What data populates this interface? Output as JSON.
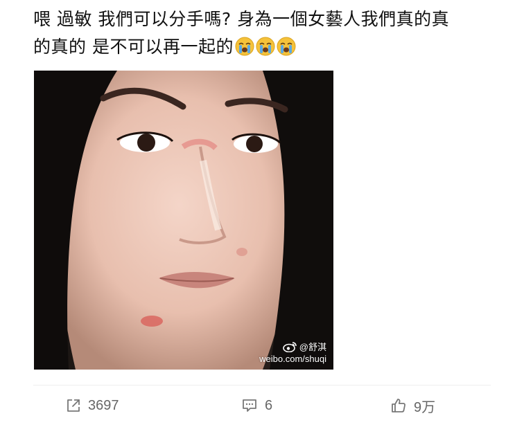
{
  "post": {
    "text_line1": "喂 過敏 我們可以分手嗎? 身為一個女藝人我們真的真",
    "text_line2": "的真的 是不可以再一起的"
  },
  "photo": {
    "watermark_user": "@舒淇",
    "watermark_url": "weibo.com/shuqi"
  },
  "actions": {
    "repost_count": "3697",
    "comment_count": "6",
    "like_count": "9万"
  },
  "colors": {
    "text": "#111111",
    "action_text": "#666666",
    "emoji_face": "#f5c23a",
    "tears": "#5aa9e6"
  },
  "icons": {
    "emoji": "crying-face-icon",
    "repost": "share-icon",
    "comment": "comment-icon",
    "like": "thumbs-up-icon",
    "watermark": "weibo-logo-icon"
  }
}
